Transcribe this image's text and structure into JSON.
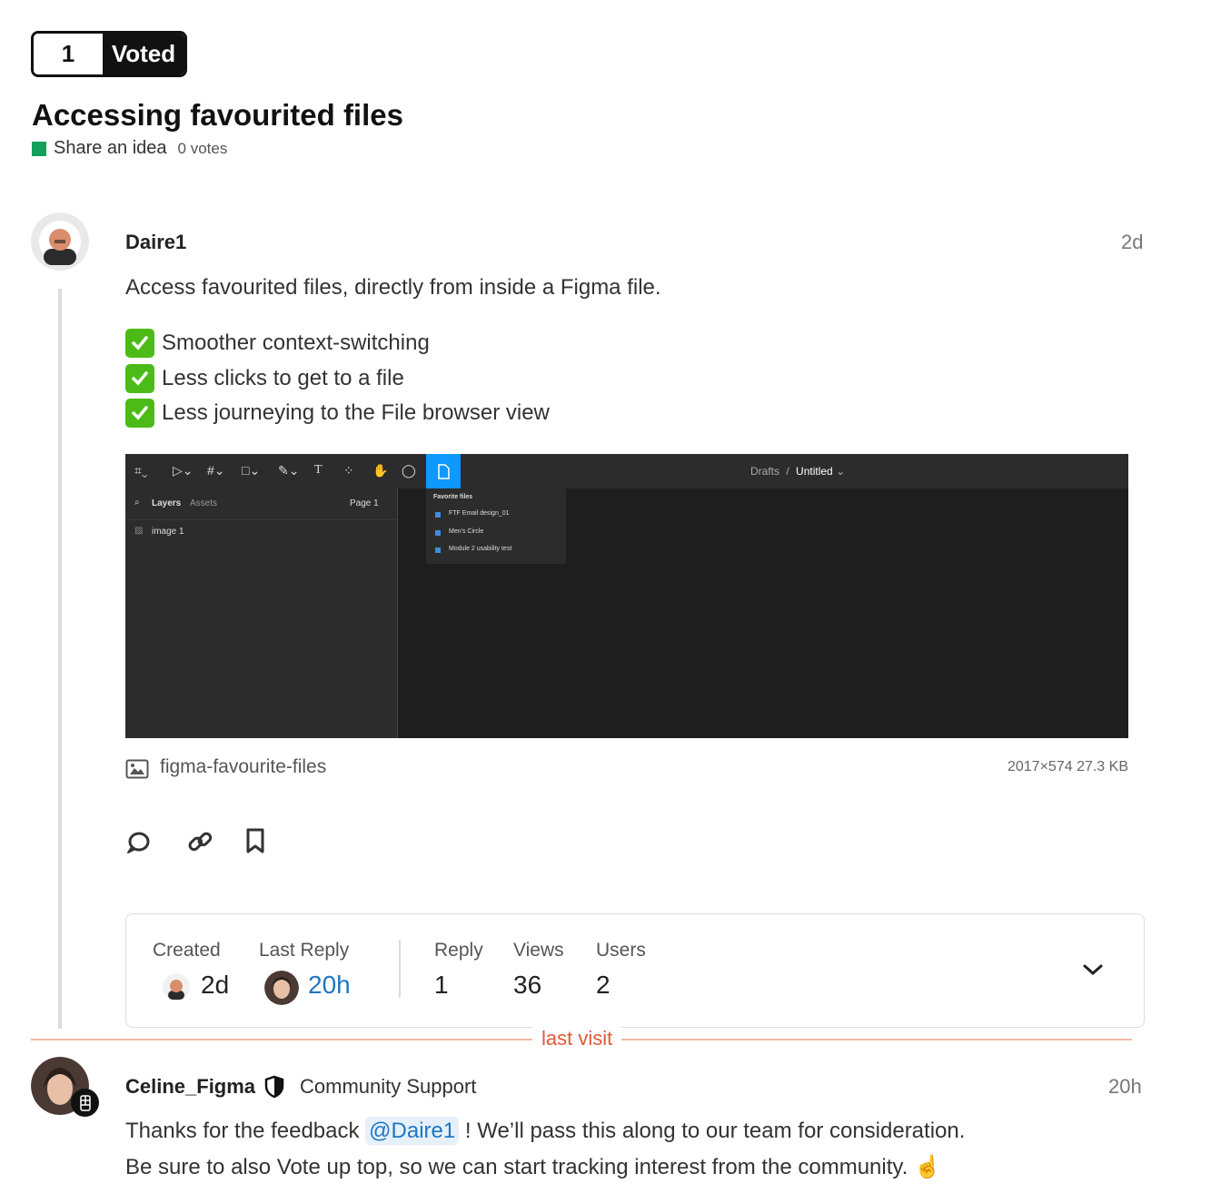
{
  "vote": {
    "count": "1",
    "button_label": "Voted"
  },
  "topic": {
    "title": "Accessing favourited files",
    "category": "Share an idea",
    "category_color": "#12a05a",
    "votes": "0 votes"
  },
  "post1": {
    "username": "Daire1",
    "age": "2d",
    "intro": "Access favourited files, directly from inside a Figma file.",
    "checklist": [
      "Smoother context-switching",
      "Less clicks to get to a file",
      "Less journeying to the File browser view"
    ],
    "embed": {
      "breadcrumb_root": "Drafts",
      "breadcrumb_sep": "/",
      "file_name": "Untitled",
      "tab_layers": "Layers",
      "tab_assets": "Assets",
      "page": "Page 1",
      "layer_name": "image 1",
      "menu_title": "Favorite files",
      "favorites": [
        "FTF Email design_01",
        "Men's Circle",
        "Module 2 usability test"
      ],
      "text_tool_glyph": "T"
    },
    "attachment": {
      "filename": "figma-favourite-files",
      "meta": "2017×574 27.3 KB"
    },
    "actions": [
      "reply-icon",
      "link-icon",
      "bookmark-icon"
    ]
  },
  "stats": {
    "created_label": "Created",
    "created_value": "2d",
    "last_reply_label": "Last Reply",
    "last_reply_value": "20h",
    "reply_label": "Reply",
    "reply_value": "1",
    "views_label": "Views",
    "views_value": "36",
    "users_label": "Users",
    "users_value": "2"
  },
  "divider_label": "last visit",
  "post2": {
    "username": "Celine_Figma",
    "group": "Community Support",
    "age": "20h",
    "line1_before": "Thanks for the feedback",
    "mention": "@Daire1",
    "line1_after": "! We’ll pass this along to our team for consideration.",
    "line2": "Be sure to also Vote up top, so we can start tracking interest from the community.",
    "emoji": "☝️"
  },
  "colors": {
    "accent": "#1f76c2",
    "last_visit": "#e45735",
    "check": "#4cbb17"
  }
}
